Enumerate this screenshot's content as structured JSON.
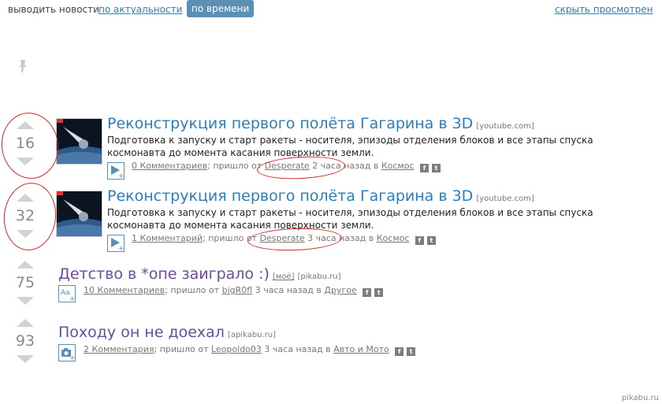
{
  "topbar": {
    "label": "выводить новости",
    "sort_relevance": "по актуальности",
    "sort_time": "по времени",
    "hide_viewed": "скрыть просмотрен"
  },
  "posts": [
    {
      "score": "16",
      "title": "Реконструкция первого полёта Гагарина в 3D",
      "domain": "[youtube.com]",
      "description": "Подготовка к запуску и старт ракеты - носителя, эпизоды отделения блоков и все этапы спуска космонавта до момента касания поверхности земли.",
      "comments": "0 Комментариев",
      "from_text": "; пришло от",
      "author": "Desperate",
      "time_text": "2 часа назад в",
      "category": "Космос",
      "type_icon": "video-icon"
    },
    {
      "score": "32",
      "title": "Реконструкция первого полёта Гагарина в 3D",
      "domain": "[youtube.com]",
      "description": "Подготовка к запуску и старт ракеты - носителя, эпизоды отделения блоков и все этапы спуска космонавта до момента касания поверхности земли.",
      "comments": "1 Комментарий",
      "from_text": "; пришло от",
      "author": "Desperate",
      "time_text": "3 часа назад в",
      "category": "Космос",
      "type_icon": "video-icon"
    },
    {
      "score": "75",
      "title": "Детство в *опе заиграло :)",
      "mine": "[моё]",
      "domain": "[pikabu.ru]",
      "comments": "10 Комментариев",
      "from_text": "; пришло от",
      "author": "bigR0fl",
      "time_text": "3 часа назад в",
      "category": "Другое",
      "type_icon": "text-icon"
    },
    {
      "score": "93",
      "title": "Походу он не доехал",
      "domain": "[apikabu.ru]",
      "comments": "2 Комментария",
      "from_text": "; пришло от",
      "author": "Leopoldo03",
      "time_text": "3 часа назад в",
      "category": "Авто и Мото",
      "type_icon": "photo-icon"
    }
  ],
  "footer": "pikabu.ru",
  "colors": {
    "link_blue": "#2a7fb8",
    "title_purple": "#6b4b9b",
    "annotation_red": "#cc2b2b"
  }
}
